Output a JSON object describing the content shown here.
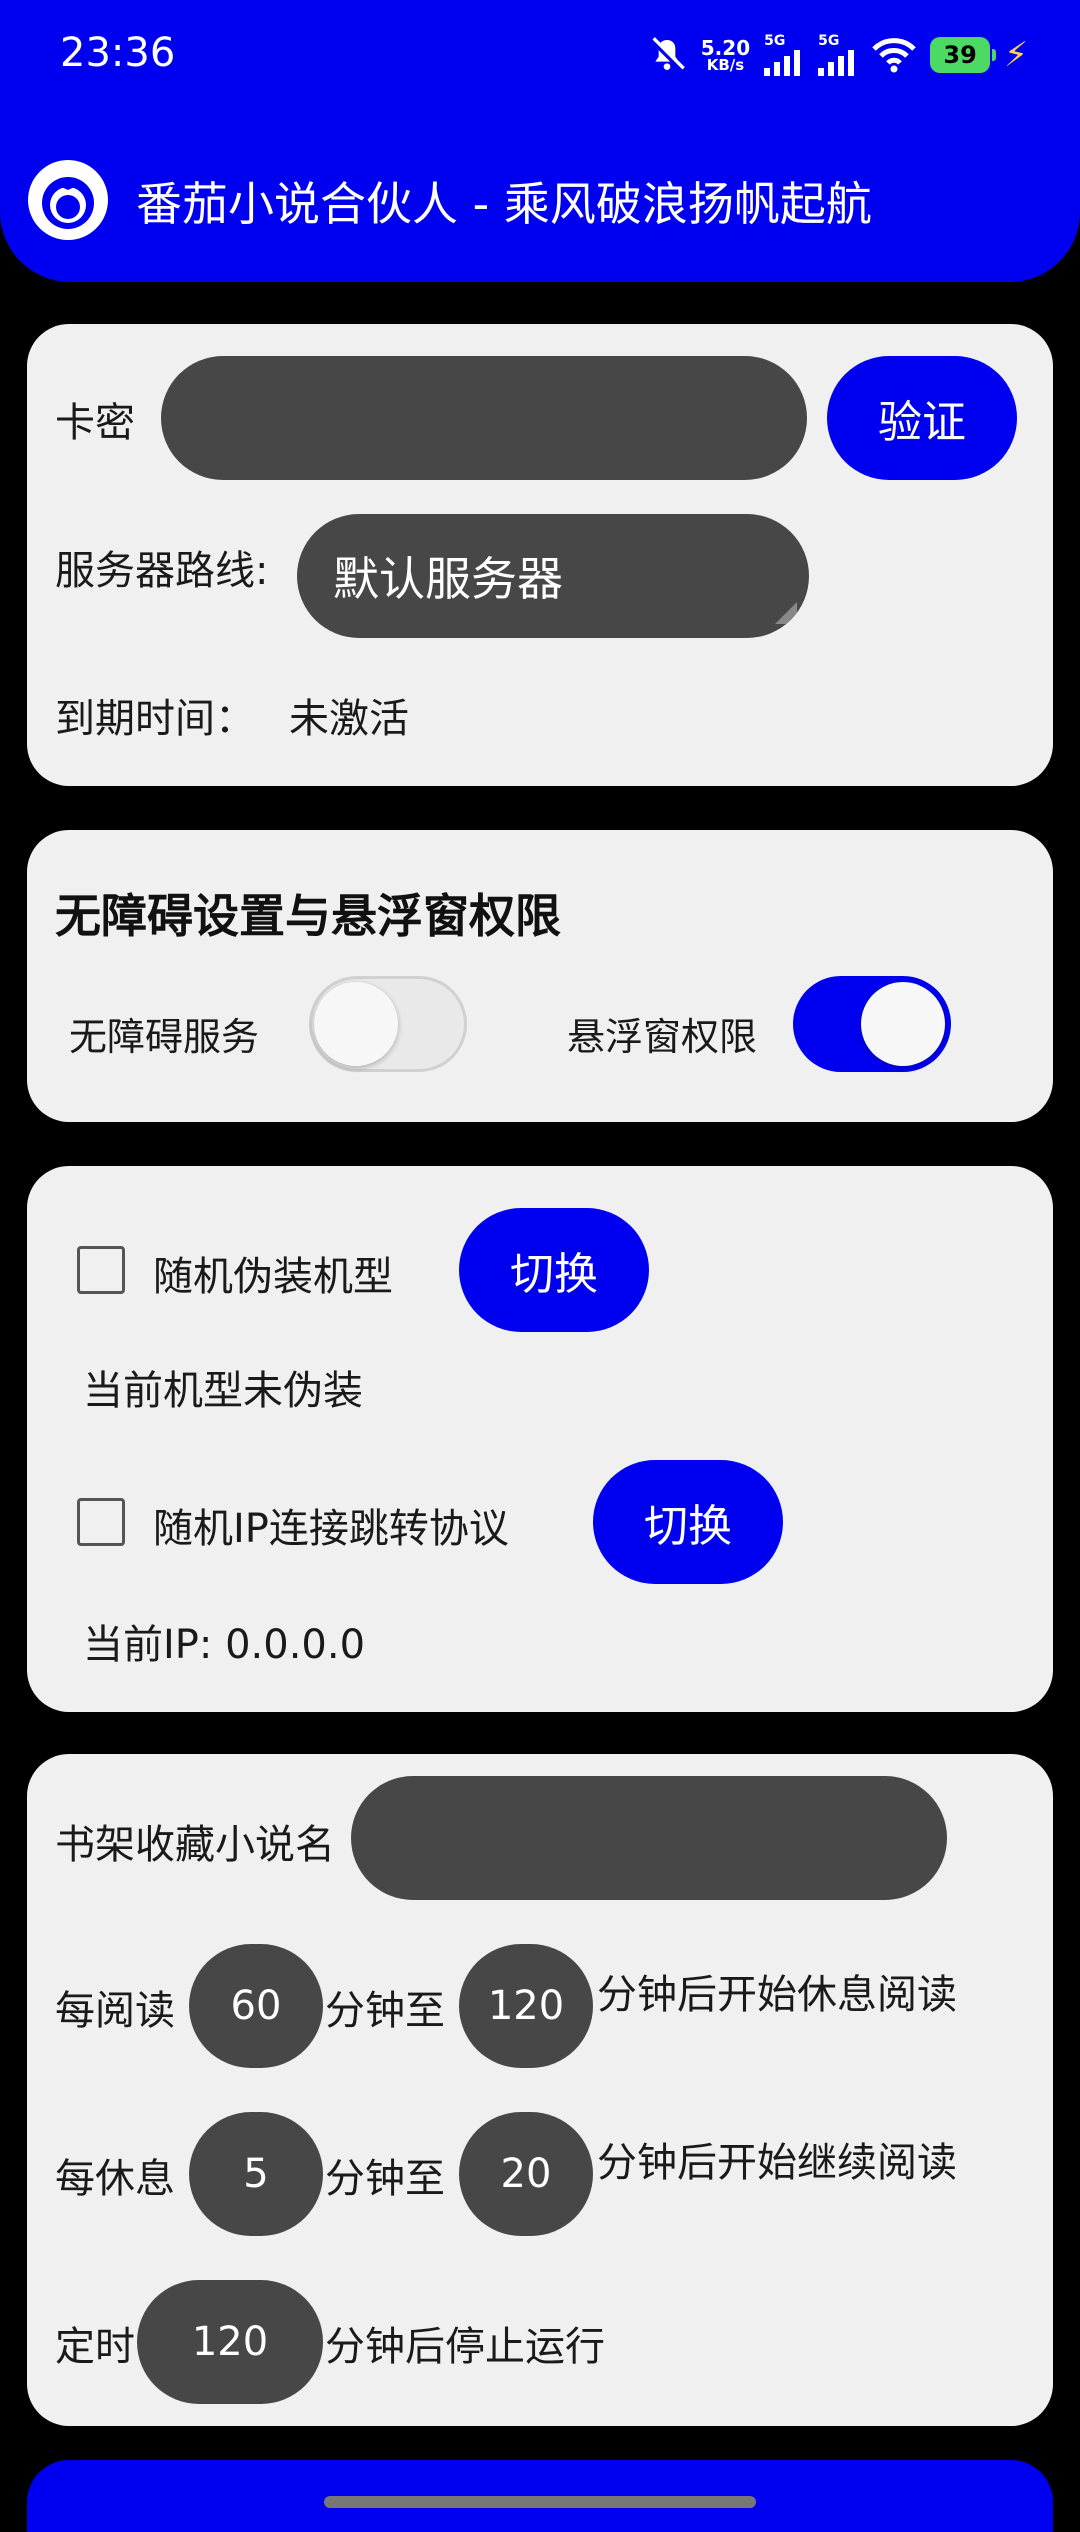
{
  "status_bar": {
    "time": "23:36",
    "net_speed_value": "5.20",
    "net_speed_unit": "KB/s",
    "sim1_label": "5G",
    "sim2_label": "5G",
    "battery": "39"
  },
  "header": {
    "title": "番茄小说合伙人 - 乘风破浪扬帆起航"
  },
  "card_key": {
    "key_label": "卡密",
    "key_value": "",
    "verify_button": "验证",
    "server_label": "服务器路线:",
    "server_value": "默认服务器",
    "expire_label": "到期时间：",
    "expire_value": "未激活"
  },
  "card_permissions": {
    "title": "无障碍设置与悬浮窗权限",
    "accessibility_label": "无障碍服务",
    "accessibility_on": false,
    "overlay_label": "悬浮窗权限",
    "overlay_on": true
  },
  "card_disguise": {
    "device_checkbox_label": "随机伪装机型",
    "device_checked": false,
    "device_switch_button": "切换",
    "device_status": "当前机型未伪装",
    "ip_checkbox_label": "随机IP连接跳转协议",
    "ip_checked": false,
    "ip_switch_button": "切换",
    "ip_status": "当前IP: 0.0.0.0"
  },
  "card_reading": {
    "bookshelf_label": "书架收藏小说名",
    "bookshelf_value": "",
    "read_prefix": "每阅读",
    "read_min": "60",
    "read_mid": "分钟至",
    "read_max": "120",
    "read_suffix": "分钟后开始休息阅读",
    "rest_prefix": "每休息",
    "rest_min": "5",
    "rest_mid": "分钟至",
    "rest_max": "20",
    "rest_suffix": "分钟后开始继续阅读",
    "timer_prefix": "定时",
    "timer_value": "120",
    "timer_suffix": "分钟后停止运行"
  }
}
